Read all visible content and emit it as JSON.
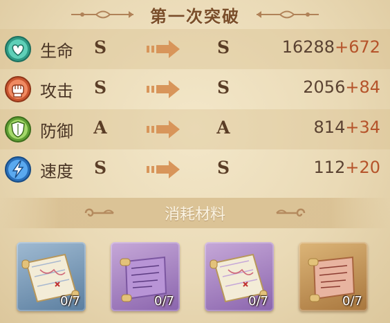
{
  "title": "第一次突破",
  "stats": [
    {
      "label": "生命",
      "icon": "heart-icon",
      "color": "#3bb39a",
      "before": "S",
      "after": "S",
      "base": "16288",
      "bonus": "+672"
    },
    {
      "label": "攻击",
      "icon": "fist-icon",
      "color": "#e0704a",
      "before": "S",
      "after": "S",
      "base": "2056",
      "bonus": "+84"
    },
    {
      "label": "防御",
      "icon": "shield-icon",
      "color": "#7dbb4a",
      "before": "A",
      "after": "A",
      "base": "814",
      "bonus": "+34"
    },
    {
      "label": "速度",
      "icon": "lightning-icon",
      "color": "#3a8ad8",
      "before": "S",
      "after": "S",
      "base": "112",
      "bonus": "+20"
    }
  ],
  "materials_title": "消耗材料",
  "materials": [
    {
      "item": "map-scroll-icon",
      "rarity": "blue",
      "count": "0/7"
    },
    {
      "item": "purple-scroll-icon",
      "rarity": "purple",
      "count": "0/7"
    },
    {
      "item": "map-scroll-icon",
      "rarity": "purple",
      "count": "0/7"
    },
    {
      "item": "parchment-scroll-icon",
      "rarity": "gold",
      "count": "0/7"
    }
  ]
}
